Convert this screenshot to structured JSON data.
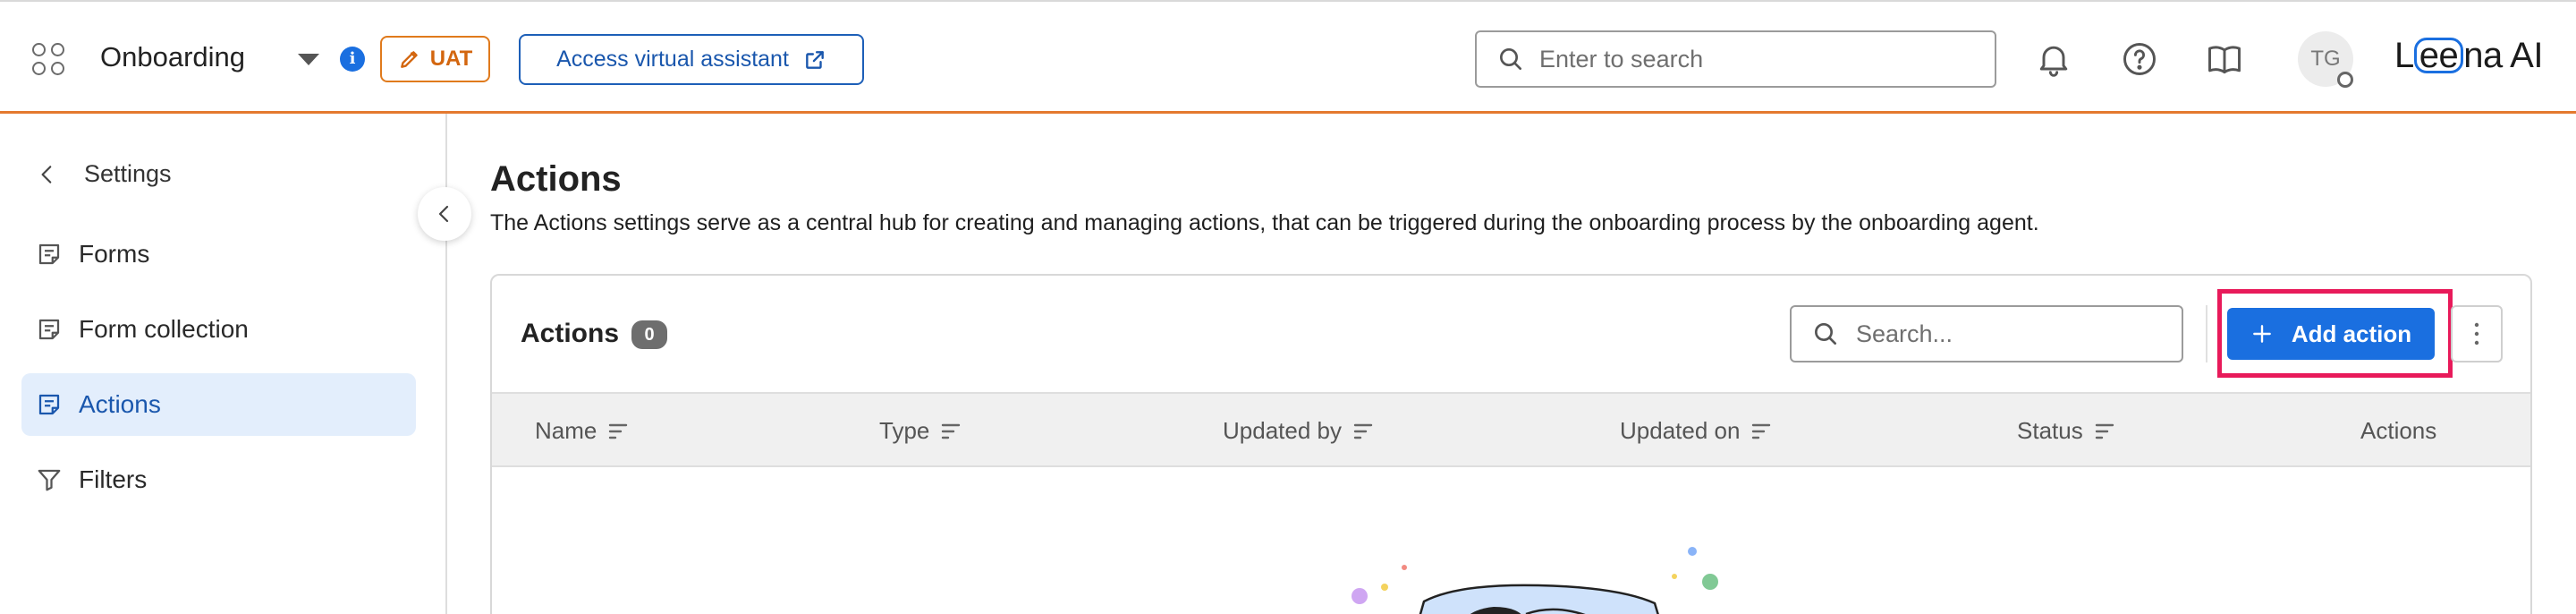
{
  "header": {
    "app_title": "Onboarding",
    "env_badge": "UAT",
    "assistant_button": "Access virtual assistant",
    "search_placeholder": "Enter to search",
    "user_initials": "TG",
    "brand_prefix": "L",
    "brand_highlight": "ee",
    "brand_suffix": "na AI",
    "colors": {
      "accent": "#1a6fe0",
      "divider": "#e4792f",
      "badge": "#e07a1c"
    }
  },
  "sidebar": {
    "back_label": "Settings",
    "items": [
      {
        "label": "Forms",
        "icon": "form-icon",
        "active": false
      },
      {
        "label": "Form collection",
        "icon": "form-icon",
        "active": false
      },
      {
        "label": "Actions",
        "icon": "form-icon",
        "active": true
      },
      {
        "label": "Filters",
        "icon": "filter-icon",
        "active": false
      }
    ]
  },
  "main": {
    "title": "Actions",
    "description": "The Actions settings serve as a central hub for creating and managing actions, that can be triggered during the onboarding process by the onboarding agent.",
    "card": {
      "title": "Actions",
      "count": "0",
      "search_placeholder": "Search...",
      "add_button": "Add action",
      "highlight_color": "#e81a5a",
      "columns": [
        "Name",
        "Type",
        "Updated by",
        "Updated on",
        "Status",
        "Actions"
      ]
    }
  }
}
